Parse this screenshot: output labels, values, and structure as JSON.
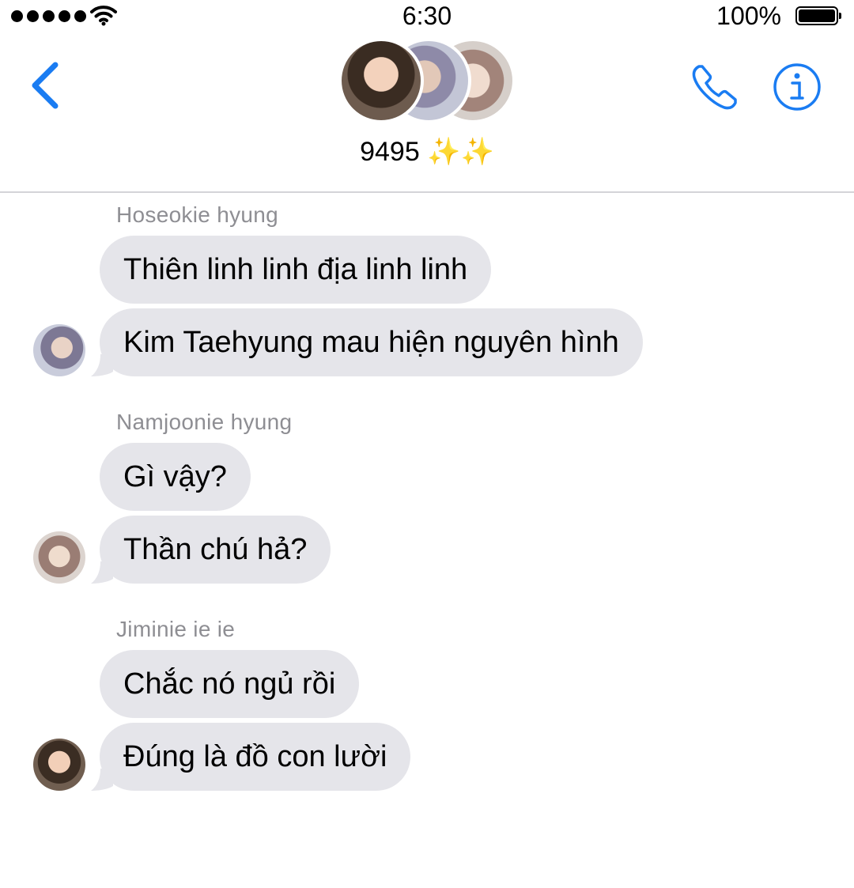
{
  "status_bar": {
    "time": "6:30",
    "battery_percent": "100%",
    "signal_bars": 5,
    "icons": [
      "signal-dots-icon",
      "wifi-icon",
      "battery-icon"
    ]
  },
  "header": {
    "group_name": "9495 ✨✨",
    "accent_color": "#1a7cf2",
    "icons": [
      "back-chevron-icon",
      "phone-icon",
      "info-icon"
    ]
  },
  "messages": [
    {
      "sender": "Hoseokie hyung",
      "bubbles": [
        "Thiên linh linh địa linh linh",
        "Kim Taehyung mau hiện nguyên hình"
      ]
    },
    {
      "sender": "Namjoonie hyung",
      "bubbles": [
        "Gì vậy?",
        "Thần chú hả?"
      ]
    },
    {
      "sender": "Jiminie ie ie",
      "bubbles": [
        "Chắc nó ngủ rồi",
        "Đúng là đồ con lười"
      ]
    }
  ],
  "colors": {
    "bubble_bg": "#e5e5ea",
    "sender_label": "#8e8e93",
    "divider": "#d4d4d8"
  }
}
